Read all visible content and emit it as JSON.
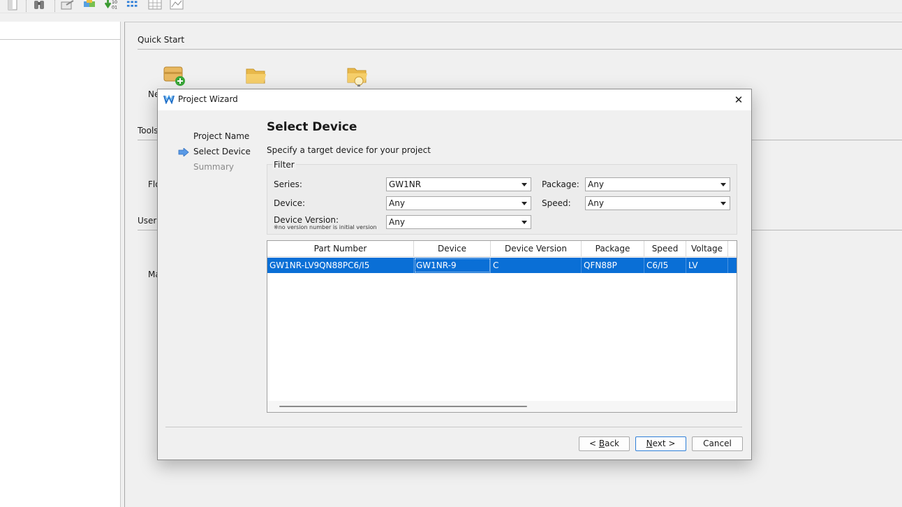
{
  "toolbar": {
    "icons": [
      "new-file-icon",
      "binoculars-icon",
      "process-icon",
      "cube-icon",
      "download-bitstream-icon",
      "list-view-icon",
      "grid-view-icon",
      "chart-icon"
    ]
  },
  "start_page": {
    "quick_start_label": "Quick Start",
    "tools_label": "Tools",
    "user_label": "User M",
    "new_label": "Ne",
    "flow_label": "Flo",
    "manual_label": "Ma"
  },
  "dialog": {
    "title": "Project Wizard",
    "close_glyph": "✕",
    "steps": [
      "Project Name",
      "Select Device",
      "Summary"
    ],
    "current_step": 1,
    "heading": "Select Device",
    "subtitle": "Specify a target device for your project",
    "filter": {
      "legend": "Filter",
      "series_label": "Series:",
      "series_value": "GW1NR",
      "package_label": "Package:",
      "package_value": "Any",
      "device_label": "Device:",
      "device_value": "Any",
      "speed_label": "Speed:",
      "speed_value": "Any",
      "version_label": "Device Version:",
      "version_note": "※no version number is initial version",
      "version_value": "Any"
    },
    "table": {
      "columns": [
        "Part Number",
        "Device",
        "Device Version",
        "Package",
        "Speed",
        "Voltage"
      ],
      "rows": [
        [
          "GW1NR-LV9QN88PC6/I5",
          "GW1NR-9",
          "C",
          "QFN88P",
          "C6/I5",
          "LV"
        ]
      ]
    },
    "buttons": {
      "back_prefix": "< ",
      "back_key": "B",
      "back_rest": "ack",
      "next_key": "N",
      "next_rest": "ext >",
      "cancel": "Cancel"
    },
    "colors": {
      "selection": "#0a6fd6",
      "accent": "#2f7fd8"
    }
  }
}
